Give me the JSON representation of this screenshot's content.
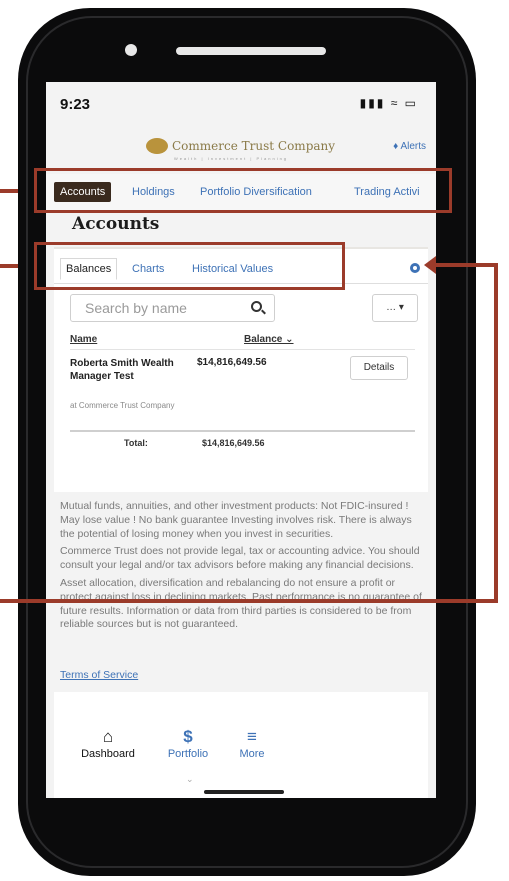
{
  "status_bar": {
    "time": "9:23",
    "icons": "signal wifi battery"
  },
  "header": {
    "logo_text": "Commerce Trust Company",
    "logo_sub": "Wealth | Investment | Planning",
    "alerts_label": "Alerts"
  },
  "tabs": [
    "Accounts",
    "Holdings",
    "Portfolio Diversification",
    "Trading Activi"
  ],
  "page_title": "Accounts",
  "sub_tabs": [
    "Balances",
    "Charts",
    "Historical Values"
  ],
  "search": {
    "placeholder": "Search by name"
  },
  "more_button": "… ▾",
  "table": {
    "headers": [
      "Name",
      "Balance ⌄"
    ],
    "rows": [
      {
        "name": "Roberta Smith Wealth Manager Test",
        "institution": "at Commerce Trust Company",
        "balance": "$14,816,649.56",
        "action": "Details"
      }
    ],
    "total_label": "Total:",
    "total_value": "$14,816,649.56"
  },
  "disclaimer": [
    "Mutual funds, annuities, and other investment products: Not FDIC-insured ! May lose value ! No bank guarantee Investing involves risk. There is always the potential of losing money when you invest in securities.",
    "Commerce Trust does not provide legal, tax or accounting advice. You should consult your legal and/or tax advisors before making any financial decisions.",
    "Asset allocation, diversification and rebalancing do not ensure a profit or protect against loss in declining markets. Past performance is no guarantee of future results. Information or data from third parties is considered to be from reliable sources but is not guaranteed."
  ],
  "terms_link": "Terms of Service",
  "bottom_nav": [
    {
      "label": "Dashboard",
      "icon": "home-icon"
    },
    {
      "label": "Portfolio",
      "icon": "dollar-icon"
    },
    {
      "label": "More",
      "icon": "menu-icon"
    }
  ],
  "colors": {
    "link": "#3e72b6",
    "active_tab": "#3a2a1e",
    "annotation": "#9b3b2a"
  }
}
